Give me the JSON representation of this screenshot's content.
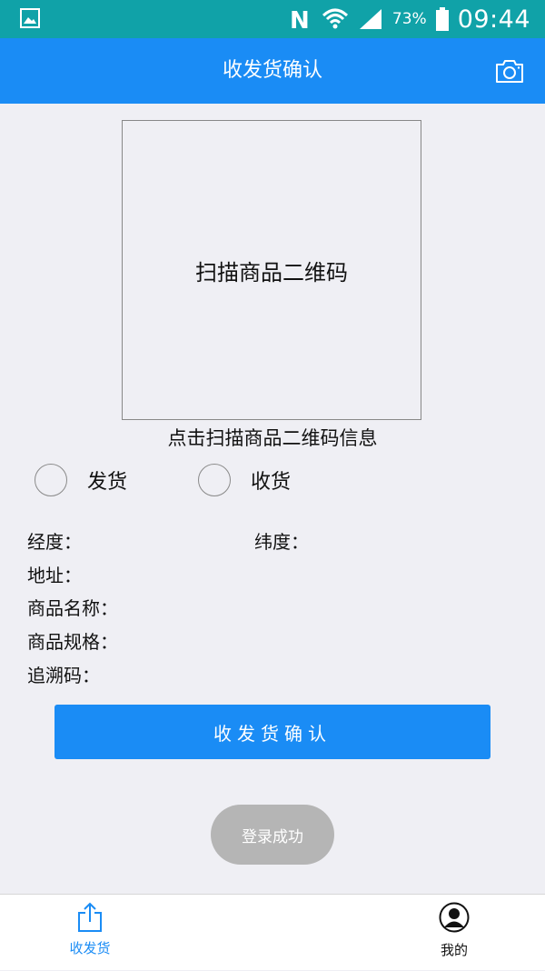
{
  "status_bar": {
    "battery_percent": "73%",
    "time": "09:44",
    "icons": [
      "gallery-icon",
      "nfc-icon",
      "wifi-icon",
      "signal-icon",
      "battery-icon"
    ]
  },
  "nav": {
    "title": "收发货确认",
    "camera_icon": "camera-icon"
  },
  "scan": {
    "box_text": "扫描商品二维码",
    "caption": "点击扫描商品二维码信息"
  },
  "radios": [
    {
      "label": "发货",
      "selected": false
    },
    {
      "label": "收货",
      "selected": false
    }
  ],
  "info": {
    "longitude": "经度：",
    "latitude": "纬度：",
    "address": "地址：",
    "product_name": "商品名称：",
    "product_spec": "商品规格：",
    "trace_code": "追溯码："
  },
  "confirm_button": "收发货确认",
  "toast": "登录成功",
  "tabs": [
    {
      "label": "收发货",
      "icon": "share-upload-icon",
      "active": true
    },
    {
      "label": "我的",
      "icon": "user-avatar-icon",
      "active": false
    }
  ],
  "colors": {
    "status_bar": "#10a2a8",
    "primary": "#1a8cf5",
    "background": "#efeff4",
    "toast": "#b5b5b5"
  }
}
